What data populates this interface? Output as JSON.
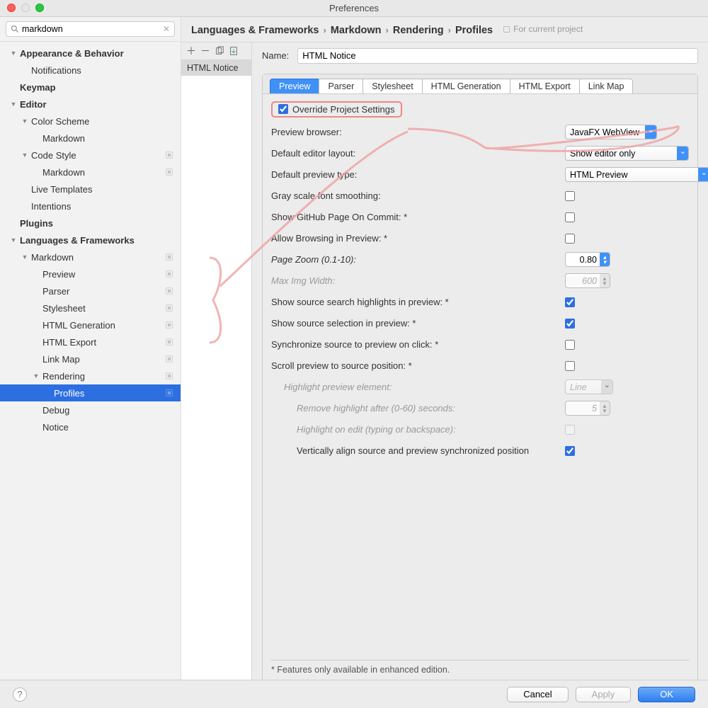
{
  "window": {
    "title": "Preferences"
  },
  "search": {
    "value": "markdown"
  },
  "sidebar": {
    "items": [
      {
        "lvl": 0,
        "bold": true,
        "arrow": "▼",
        "label": "Appearance & Behavior",
        "ind": false
      },
      {
        "lvl": 1,
        "bold": false,
        "arrow": "",
        "label": "Notifications",
        "ind": false
      },
      {
        "lvl": 0,
        "bold": true,
        "arrow": "",
        "label": "Keymap",
        "ind": false
      },
      {
        "lvl": 0,
        "bold": true,
        "arrow": "▼",
        "label": "Editor",
        "ind": false
      },
      {
        "lvl": 1,
        "bold": false,
        "arrow": "▼",
        "label": "Color Scheme",
        "ind": false
      },
      {
        "lvl": 2,
        "bold": false,
        "arrow": "",
        "label": "Markdown",
        "ind": false
      },
      {
        "lvl": 1,
        "bold": false,
        "arrow": "▼",
        "label": "Code Style",
        "ind": true
      },
      {
        "lvl": 2,
        "bold": false,
        "arrow": "",
        "label": "Markdown",
        "ind": true
      },
      {
        "lvl": 1,
        "bold": false,
        "arrow": "",
        "label": "Live Templates",
        "ind": false
      },
      {
        "lvl": 1,
        "bold": false,
        "arrow": "",
        "label": "Intentions",
        "ind": false
      },
      {
        "lvl": 0,
        "bold": true,
        "arrow": "",
        "label": "Plugins",
        "ind": false
      },
      {
        "lvl": 0,
        "bold": true,
        "arrow": "▼",
        "label": "Languages & Frameworks",
        "ind": false
      },
      {
        "lvl": 1,
        "bold": false,
        "arrow": "▼",
        "label": "Markdown",
        "ind": true
      },
      {
        "lvl": 2,
        "bold": false,
        "arrow": "",
        "label": "Preview",
        "ind": true
      },
      {
        "lvl": 2,
        "bold": false,
        "arrow": "",
        "label": "Parser",
        "ind": true
      },
      {
        "lvl": 2,
        "bold": false,
        "arrow": "",
        "label": "Stylesheet",
        "ind": true
      },
      {
        "lvl": 2,
        "bold": false,
        "arrow": "",
        "label": "HTML Generation",
        "ind": true
      },
      {
        "lvl": 2,
        "bold": false,
        "arrow": "",
        "label": "HTML Export",
        "ind": true
      },
      {
        "lvl": 2,
        "bold": false,
        "arrow": "",
        "label": "Link Map",
        "ind": true
      },
      {
        "lvl": 2,
        "bold": false,
        "arrow": "▼",
        "label": "Rendering",
        "ind": true
      },
      {
        "lvl": 3,
        "bold": false,
        "arrow": "",
        "label": "Profiles",
        "ind": true,
        "sel": true
      },
      {
        "lvl": 2,
        "bold": false,
        "arrow": "",
        "label": "Debug",
        "ind": false
      },
      {
        "lvl": 2,
        "bold": false,
        "arrow": "",
        "label": "Notice",
        "ind": false
      }
    ]
  },
  "breadcrumb": {
    "parts": [
      "Languages & Frameworks",
      "Markdown",
      "Rendering",
      "Profiles"
    ],
    "note": "For current project"
  },
  "profile_list": {
    "selected": "HTML Notice"
  },
  "form": {
    "name_label": "Name:",
    "name_value": "HTML Notice",
    "tabs": [
      "Preview",
      "Parser",
      "Stylesheet",
      "HTML Generation",
      "HTML Export",
      "Link Map"
    ],
    "override_label": "Override Project Settings",
    "override_checked": true,
    "settings": {
      "preview_browser": {
        "label": "Preview browser:",
        "value": "JavaFX WebView"
      },
      "default_editor_layout": {
        "label": "Default editor layout:",
        "value": "Show editor only"
      },
      "default_preview_type": {
        "label": "Default preview type:",
        "value": "HTML Preview"
      },
      "gray_scale": {
        "label": "Gray scale font smoothing:",
        "checked": false
      },
      "github_page": {
        "label": "Show GitHub Page On Commit: *",
        "checked": false
      },
      "allow_browsing": {
        "label": "Allow Browsing in Preview: *",
        "checked": false
      },
      "page_zoom": {
        "label": "Page Zoom (0.1-10):",
        "value": "0.80"
      },
      "max_img_width": {
        "label": "Max Img Width:",
        "value": "600"
      },
      "show_source_search": {
        "label": "Show source search highlights in preview: *",
        "checked": true
      },
      "show_source_selection": {
        "label": "Show source selection in preview: *",
        "checked": true
      },
      "sync_click": {
        "label": "Synchronize source to preview on click: *",
        "checked": false
      },
      "scroll_preview": {
        "label": "Scroll preview to source position: *",
        "checked": false
      },
      "highlight_element": {
        "label": "Highlight preview element:",
        "value": "Line"
      },
      "remove_highlight": {
        "label": "Remove highlight after (0-60) seconds:",
        "value": "5"
      },
      "highlight_on_edit": {
        "label": "Highlight on edit (typing or backspace):",
        "checked": false
      },
      "vertically_align": {
        "label": "Vertically align source and preview synchronized position",
        "checked": true
      }
    },
    "footnote": "* Features only available in enhanced edition."
  },
  "buttons": {
    "cancel": "Cancel",
    "apply": "Apply",
    "ok": "OK",
    "help": "?"
  }
}
